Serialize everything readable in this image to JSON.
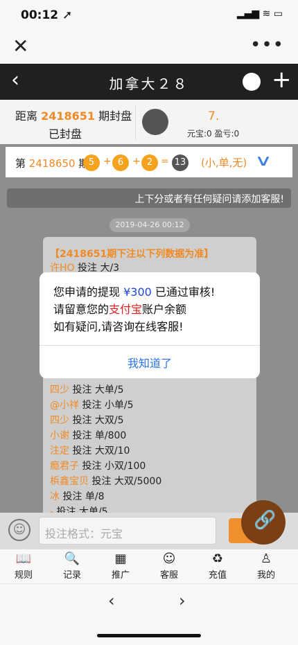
{
  "status_bar": {
    "time": "00:12 ➚",
    "icons": "▂▄▆ ≋ ▭"
  },
  "browser": {
    "close_icon": "✕",
    "more_icon": "•••"
  },
  "header": {
    "back_icon": "‹",
    "title": "加拿大２８",
    "plus_icon": "+"
  },
  "draw": {
    "prefix": "距离 ",
    "period": "2418651",
    "suffix": " 期封盘",
    "status": "已封盘",
    "score": "7.",
    "balance": "元宝:0 盈亏:0"
  },
  "result": {
    "prefix": "第 ",
    "period": "2418650",
    "suffix": " 期",
    "balls": [
      "5",
      "6",
      "2",
      "13"
    ],
    "ops": [
      "+",
      "+",
      "="
    ],
    "tags": "(小,单,无)",
    "chevron": "∨"
  },
  "notice": "上下分或者有任何疑问请添加客服!",
  "timestamp": "2019-04-26 00:12",
  "card": {
    "header": "【2418651期下注以下列数据为准】",
    "rows": [
      {
        "name": "许HO",
        "text": " 投注 大/3"
      },
      {
        "name": "四少",
        "text": " 投注 大单/5"
      },
      {
        "name": "@小祥",
        "text": " 投注 小单/5"
      },
      {
        "name": "四少",
        "text": " 投注 大双/5"
      },
      {
        "name": "小谢",
        "text": " 投注 单/800"
      },
      {
        "name": "注定",
        "text": " 投注 大双/10"
      },
      {
        "name": "瘾君子",
        "text": " 投注 小双/100"
      },
      {
        "name": "梹鑫宝贝",
        "text": " 投注 大双/5000"
      },
      {
        "name": "冰",
        "text": " 投注 单/8"
      },
      {
        "name": "-",
        "text": " 投注 大单/5"
      }
    ]
  },
  "modal": {
    "line1_a": "您申请的提现 ",
    "amount": "¥300",
    "line1_b": " 已通过审核!",
    "line2_a": "请留意您的",
    "alipay": "支付宝",
    "line2_b": "账户余额",
    "line3": "如有疑问,请咨询在线客服!",
    "ok": "我知道了"
  },
  "input": {
    "placeholder": "投注格式：元宝",
    "emoji_icon": "☺",
    "link_icon": "🔗"
  },
  "tabs": [
    {
      "label": "规则",
      "icon": "📖"
    },
    {
      "label": "记录",
      "icon": "🔍"
    },
    {
      "label": "推广",
      "icon": "▦"
    },
    {
      "label": "客服",
      "icon": "☺"
    },
    {
      "label": "充值",
      "icon": "♻"
    },
    {
      "label": "我的",
      "icon": "♙"
    }
  ],
  "nav": {
    "prev": "‹",
    "next": "›"
  },
  "colors": {
    "accent": "#f08a24",
    "blue": "#2b74e8",
    "header": "#202020"
  }
}
